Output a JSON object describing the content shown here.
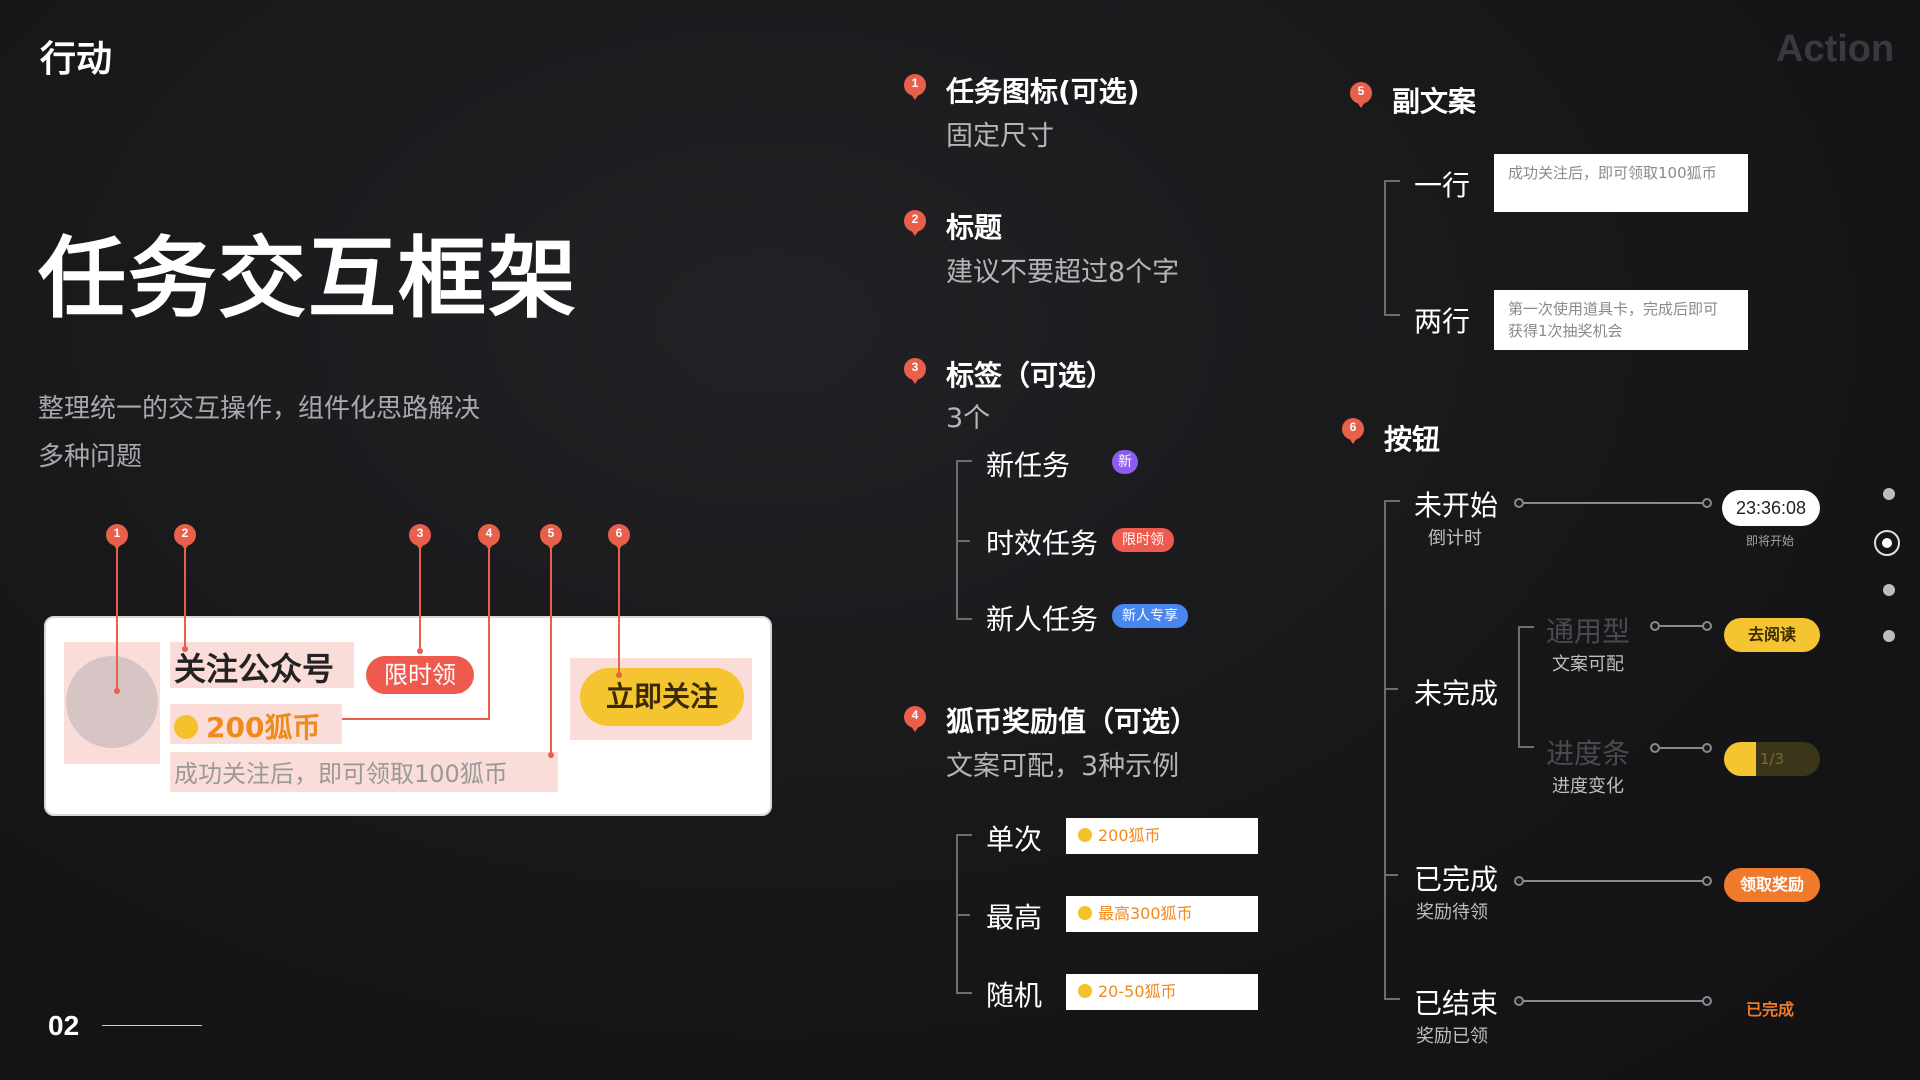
{
  "header": {
    "section": "行动",
    "watermark": "Action",
    "page_number": "02"
  },
  "hero": {
    "title": "任务交互框架",
    "desc_line1": "整理统一的交互操作，组件化思路解决",
    "desc_line2": "多种问题"
  },
  "example_card": {
    "title": "关注公众号",
    "tag": "限时领",
    "reward": "200狐币",
    "subtitle": "成功关注后，即可领取100狐币",
    "button": "立即关注",
    "markers": [
      "1",
      "2",
      "3",
      "4",
      "5",
      "6"
    ]
  },
  "sections": {
    "s1": {
      "num": "1",
      "title": "任务图标(可选)",
      "sub": "固定尺寸"
    },
    "s2": {
      "num": "2",
      "title": "标题",
      "sub": "建议不要超过8个字"
    },
    "s3": {
      "num": "3",
      "title": "标签（可选）",
      "sub": "3个",
      "items": [
        {
          "label": "新任务",
          "badge": "新"
        },
        {
          "label": "时效任务",
          "badge": "限时领"
        },
        {
          "label": "新人任务",
          "badge": "新人专享"
        }
      ]
    },
    "s4": {
      "num": "4",
      "title": "狐币奖励值（可选）",
      "sub": "文案可配，3种示例",
      "items": [
        {
          "label": "单次",
          "value": "200狐币"
        },
        {
          "label": "最高",
          "value": "最高300狐币"
        },
        {
          "label": "随机",
          "value": "20-50狐币"
        }
      ]
    },
    "s5": {
      "num": "5",
      "title": "副文案",
      "items": [
        {
          "label": "一行",
          "text1": "成功关注后，即可领取100狐币",
          "text2": ""
        },
        {
          "label": "两行",
          "text1": "第一次使用道具卡，完成后即可",
          "text2": "获得1次抽奖机会"
        }
      ]
    },
    "s6": {
      "num": "6",
      "title": "按钮",
      "not_started": {
        "label": "未开始",
        "sub": "倒计时",
        "button": "23:36:08",
        "button_sub": "即将开始"
      },
      "incomplete": {
        "label": "未完成",
        "general": {
          "label": "通用型",
          "sub": "文案可配",
          "button": "去阅读"
        },
        "progress": {
          "label": "进度条",
          "sub": "进度变化",
          "button": "1/3",
          "fraction": 0.333
        }
      },
      "completed": {
        "label": "已完成",
        "sub": "奖励待领",
        "button": "领取奖励"
      },
      "ended": {
        "label": "已结束",
        "sub": "奖励已领",
        "button": "已完成"
      }
    }
  },
  "colors": {
    "accent_red": "#e8604c",
    "yellow": "#f5c531",
    "orange": "#f07a2a",
    "purple": "#8c5cf0",
    "blue": "#4a86f0"
  }
}
